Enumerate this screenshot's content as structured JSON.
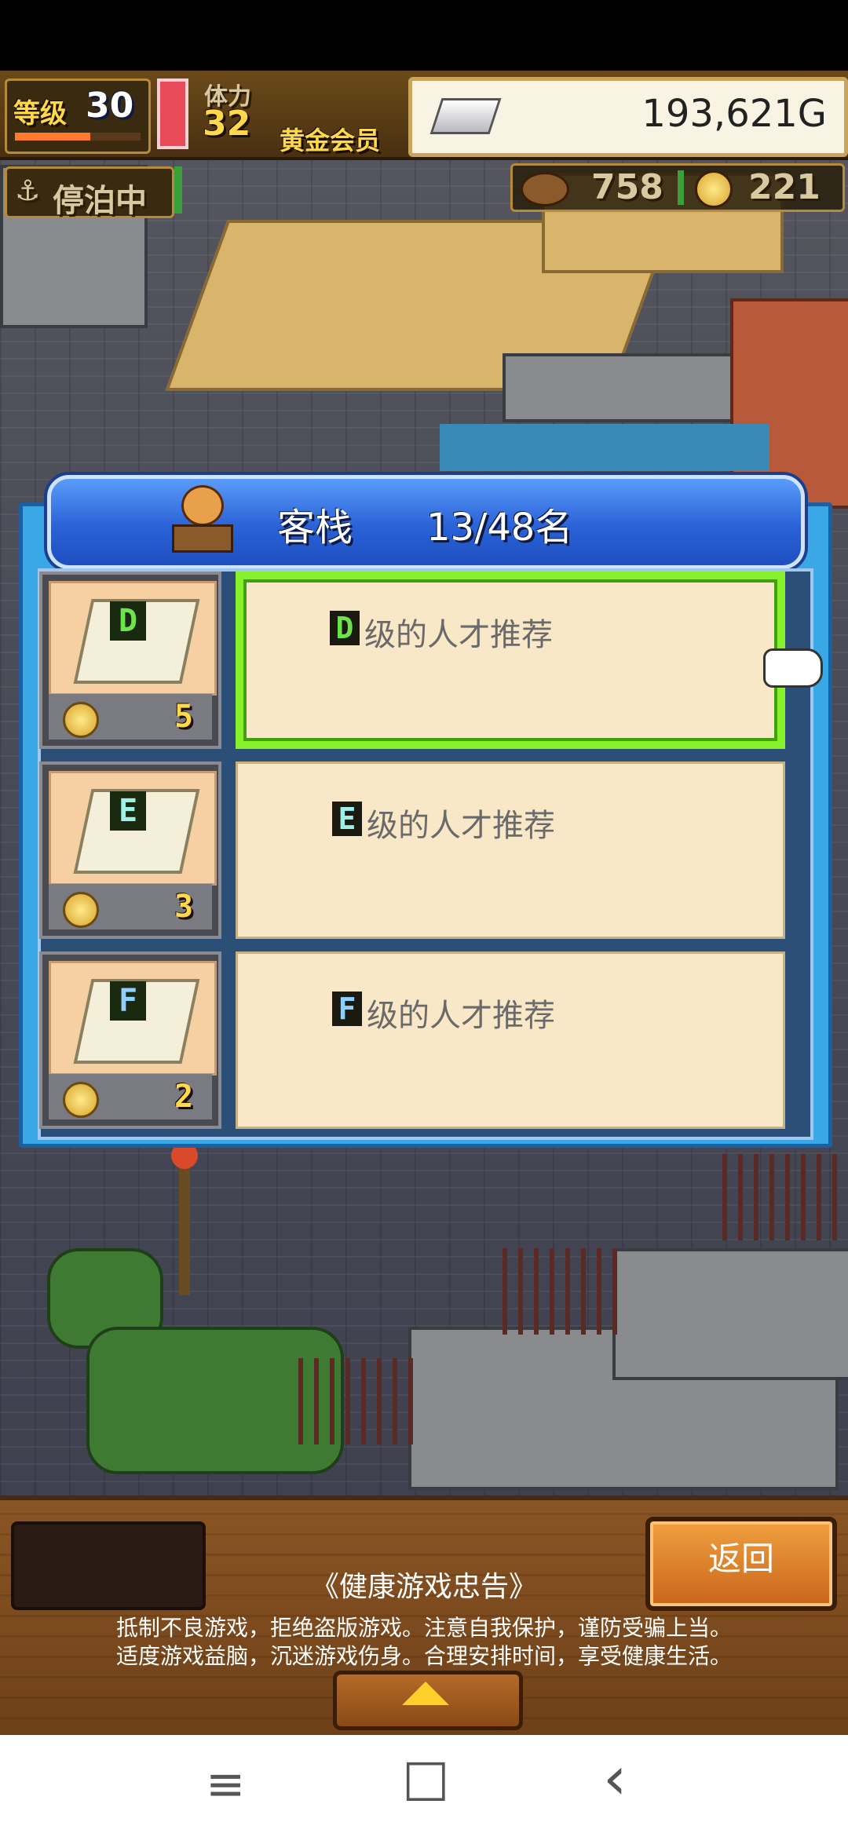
{
  "hud": {
    "level_label": "等级",
    "level_value": "30",
    "stamina_label": "体力",
    "stamina_value": "32",
    "membership": "黄金会员",
    "gold": "193,621G",
    "moored_status": "停泊中",
    "resource_a": "758",
    "resource_b": "221"
  },
  "dialog": {
    "title": "客栈",
    "count": "13/48名",
    "items": [
      {
        "rank": "D",
        "label": "级的人才推荐",
        "cost": "5",
        "rank_color": "#6ee34a"
      },
      {
        "rank": "E",
        "label": "级的人才推荐",
        "cost": "3",
        "rank_color": "#9ff0e6"
      },
      {
        "rank": "F",
        "label": "级的人才推荐",
        "cost": "2",
        "rank_color": "#8fd0ff"
      }
    ]
  },
  "bottom": {
    "return_label": "返回",
    "notice_title": "《健康游戏忠告》",
    "notice_line1": "抵制不良游戏，拒绝盗版游戏。注意自我保护，谨防受骗上当。",
    "notice_line2": "适度游戏益脑，沉迷游戏伤身。合理安排时间，享受健康生活。"
  },
  "nav": {
    "menu_icon": "≡",
    "home_icon": "□",
    "back_icon": "‹"
  }
}
